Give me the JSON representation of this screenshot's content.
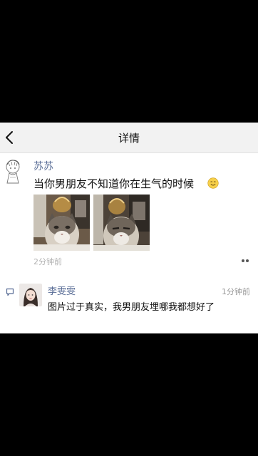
{
  "nav": {
    "title": "详情"
  },
  "post": {
    "author": "苏苏",
    "text": "当你男朋友不知道你在生气的时候",
    "time": "2分钟前",
    "images": [
      {
        "icon": "cat-photo"
      },
      {
        "icon": "cat-photo"
      }
    ]
  },
  "comments": [
    {
      "author": "李雯雯",
      "time": "1分钟前",
      "text": "图片过于真实，我男朋友埋哪我都想好了"
    }
  ],
  "colors": {
    "author_link": "#576b95",
    "nav_bg": "#f2f2f2",
    "secondary_text": "#b2b2b2"
  }
}
